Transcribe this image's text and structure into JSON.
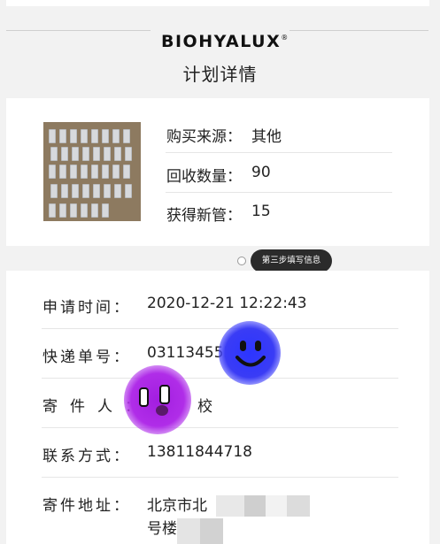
{
  "brand": {
    "name": "BIOHYALUX",
    "mark": "®"
  },
  "page": {
    "title": "计划详情"
  },
  "summary": {
    "rows": [
      {
        "label": "购买来源：",
        "value": "其他"
      },
      {
        "label": "回收数量：",
        "value": "90"
      },
      {
        "label": "获得新管：",
        "value": "15"
      }
    ]
  },
  "step": {
    "label": "第三步填写信息"
  },
  "details": {
    "rows": [
      {
        "label": "申请时间：",
        "value": "2020-12-21 12:22:43"
      },
      {
        "label": "快递单号：",
        "value": "031134555"
      },
      {
        "label": "寄件人：",
        "value": "校"
      },
      {
        "label": "联系方式：",
        "value": "13811844718"
      },
      {
        "label": "寄件地址：",
        "value": "北京市北",
        "value_line2": "号楼"
      }
    ]
  },
  "colors": {
    "background": "#f2f2f2",
    "card": "#ffffff",
    "divider": "#e6e6e6",
    "pill": "#2b2b2b",
    "sticker_blue": "#2c35ff",
    "sticker_purple": "#a21ee0"
  }
}
